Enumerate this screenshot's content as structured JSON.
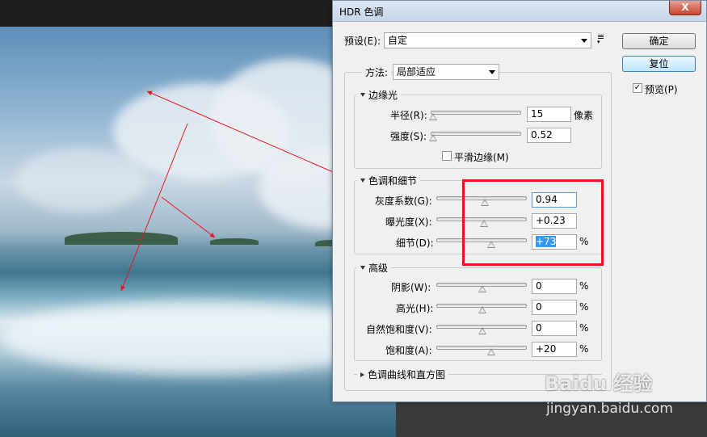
{
  "dialog": {
    "title": "HDR 色调",
    "close_glyph": "X",
    "preset_label": "预设(E):",
    "preset_value": "自定",
    "ok_button": "确定",
    "reset_button": "复位",
    "preview_label": "预览(P)",
    "preview_checked": true,
    "method_label": "方法:",
    "method_value": "局部适应"
  },
  "edge_glow": {
    "title": "边缘光",
    "radius_label": "半径(R):",
    "radius_value": "15",
    "radius_unit": "像素",
    "radius_level": 0.02,
    "strength_label": "强度(S):",
    "strength_value": "0.52",
    "strength_level": 0.02,
    "smooth_label": "平滑边缘(M)",
    "smooth_checked": false
  },
  "tone_detail": {
    "title": "色调和细节",
    "gamma_label": "灰度系数(G):",
    "gamma_value": "0.94",
    "gamma_level": 0.53,
    "exposure_label": "曝光度(X):",
    "exposure_value": "+0.23",
    "exposure_level": 0.52,
    "detail_label": "细节(D):",
    "detail_value": "+73",
    "detail_unit": "%",
    "detail_level": 0.6
  },
  "advanced": {
    "title": "高级",
    "shadow_label": "阴影(W):",
    "shadow_value": "0",
    "shadow_unit": "%",
    "shadow_level": 0.5,
    "highlight_label": "高光(H):",
    "highlight_value": "0",
    "highlight_unit": "%",
    "highlight_level": 0.5,
    "vibrance_label": "自然饱和度(V):",
    "vibrance_value": "0",
    "vibrance_unit": "%",
    "vibrance_level": 0.5,
    "saturation_label": "饱和度(A):",
    "saturation_value": "+20",
    "saturation_unit": "%",
    "saturation_level": 0.6
  },
  "curve_section": {
    "title": "色调曲线和直方图"
  },
  "watermark": {
    "brand": "Baidu 经验",
    "url": "jingyan.baidu.com"
  },
  "colors": {
    "annotation_red": "#e8141e",
    "selection_blue": "#3399ff"
  }
}
